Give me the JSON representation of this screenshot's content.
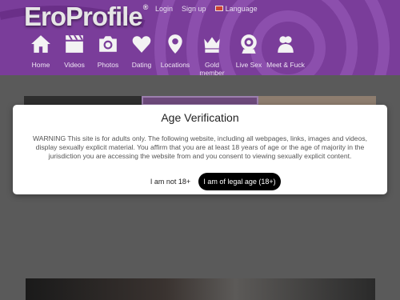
{
  "brand": {
    "logo_text": "EroProfile",
    "reg_mark": "®"
  },
  "top_links": {
    "login": "Login",
    "signup": "Sign up",
    "language": "Language"
  },
  "nav": [
    {
      "label": "Home",
      "icon": "home-icon"
    },
    {
      "label": "Videos",
      "icon": "clapperboard-icon"
    },
    {
      "label": "Photos",
      "icon": "camera-icon"
    },
    {
      "label": "Dating",
      "icon": "heart-icon"
    },
    {
      "label": "Locations",
      "icon": "map-pin-icon"
    },
    {
      "label": "Gold member",
      "icon": "crown-icon"
    },
    {
      "label": "Live Sex",
      "icon": "webcam-icon"
    },
    {
      "label": "Meet & Fuck",
      "icon": "meet-icon"
    }
  ],
  "modal": {
    "title": "Age Verification",
    "text": "WARNING This site is for adults only. The following website, including all webpages, links, images and videos, display sexually explicit material. You affirm that you are at least 18 years of age or the age of majority in the jurisdiction you are accessing the website from and you consent to viewing sexually explicit content.",
    "decline_label": "I am not 18+",
    "accept_label": "I am of legal age (18+)"
  },
  "colors": {
    "header": "#7a3d9a",
    "overlay": "#5a5a5a",
    "accept_bg": "#000000"
  }
}
